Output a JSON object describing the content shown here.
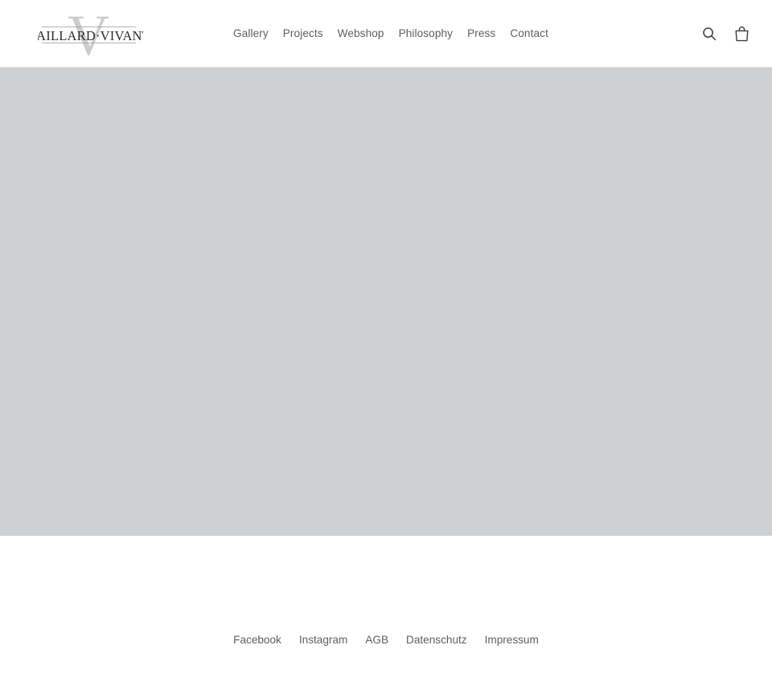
{
  "site": {
    "brand_name": "GAILLARD VIVANT",
    "brand_word_1": "GAILLARD",
    "brand_separator": "·",
    "brand_word_2": "VIVANT",
    "brand_monogram": "V"
  },
  "header": {
    "nav": [
      {
        "label": "Gallery",
        "name": "nav-link-gallery"
      },
      {
        "label": "Projects",
        "name": "nav-link-projects"
      },
      {
        "label": "Webshop",
        "name": "nav-link-webshop"
      },
      {
        "label": "Philosophy",
        "name": "nav-link-philosophy"
      },
      {
        "label": "Press",
        "name": "nav-link-press"
      },
      {
        "label": "Contact",
        "name": "nav-link-contact"
      }
    ],
    "actions": {
      "search_icon": "search-icon",
      "cart_icon": "shopping-bag-icon"
    }
  },
  "hero": {
    "placeholder_color": "#cfd0d2"
  },
  "footer": {
    "links": [
      {
        "label": "Facebook",
        "name": "footer-link-facebook"
      },
      {
        "label": "Instagram",
        "name": "footer-link-instagram"
      },
      {
        "label": "AGB",
        "name": "footer-link-agb"
      },
      {
        "label": "Datenschutz",
        "name": "footer-link-datenschutz"
      },
      {
        "label": "Impressum",
        "name": "footer-link-impressum"
      }
    ]
  },
  "colors": {
    "text": "#5f5f5f",
    "icon": "#3d3d3d",
    "placeholder": "#cfd0d2",
    "logo_text": "#2b2b2b",
    "logo_monogram": "#cccccc",
    "border": "#ececec"
  }
}
